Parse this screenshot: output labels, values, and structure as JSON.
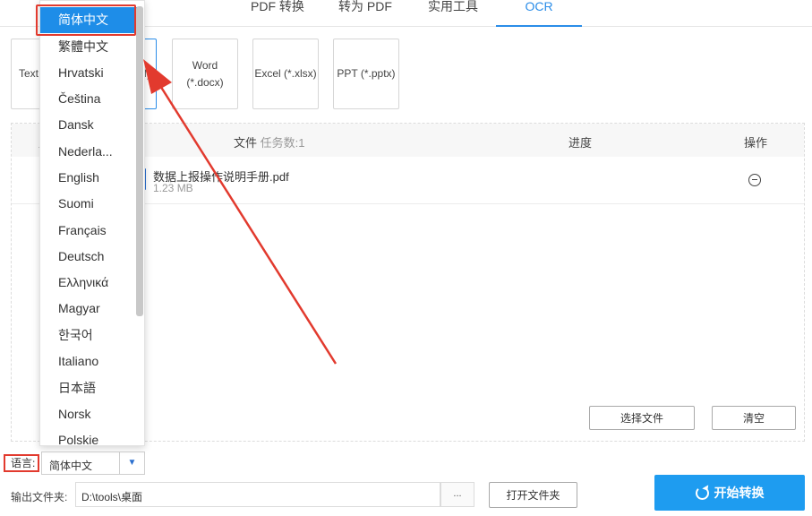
{
  "tabs": [
    {
      "label": "PDF 转换"
    },
    {
      "label": "转为 PDF"
    },
    {
      "label": "实用工具"
    },
    {
      "label": "OCR"
    }
  ],
  "formats": {
    "text_partial": "Text",
    "pdf_partial": "f)",
    "word_line1": "Word",
    "word_line2": "(*.docx)",
    "excel": "Excel (*.xlsx)",
    "ppt": "PPT (*.pptx)"
  },
  "table": {
    "col_file": "文件",
    "task_count": "任务数:1",
    "col_progress": "进度",
    "col_action": "操作",
    "col_partial": "月",
    "rows": [
      {
        "name": "数据上报操作说明手册.pdf",
        "size": "1.23 MB"
      }
    ]
  },
  "buttons": {
    "select_file": "选择文件",
    "clear": "清空",
    "open_folder": "打开文件夹",
    "start": "开始转换",
    "browse": "..."
  },
  "language": {
    "label": "语言:",
    "value": "简体中文",
    "options": [
      "简体中文",
      "繁體中文",
      "Hrvatski",
      "Čeština",
      "Dansk",
      "Nederla...",
      "English",
      "Suomi",
      "Français",
      "Deutsch",
      "Ελληνικά",
      "Magyar",
      "한국어",
      "Italiano",
      "日本語",
      "Norsk",
      "Polskie"
    ]
  },
  "output": {
    "label": "输出文件夹:",
    "path": "D:\\tools\\桌面"
  },
  "colors": {
    "accent": "#1e9cf0",
    "highlight": "#e23a2e"
  }
}
